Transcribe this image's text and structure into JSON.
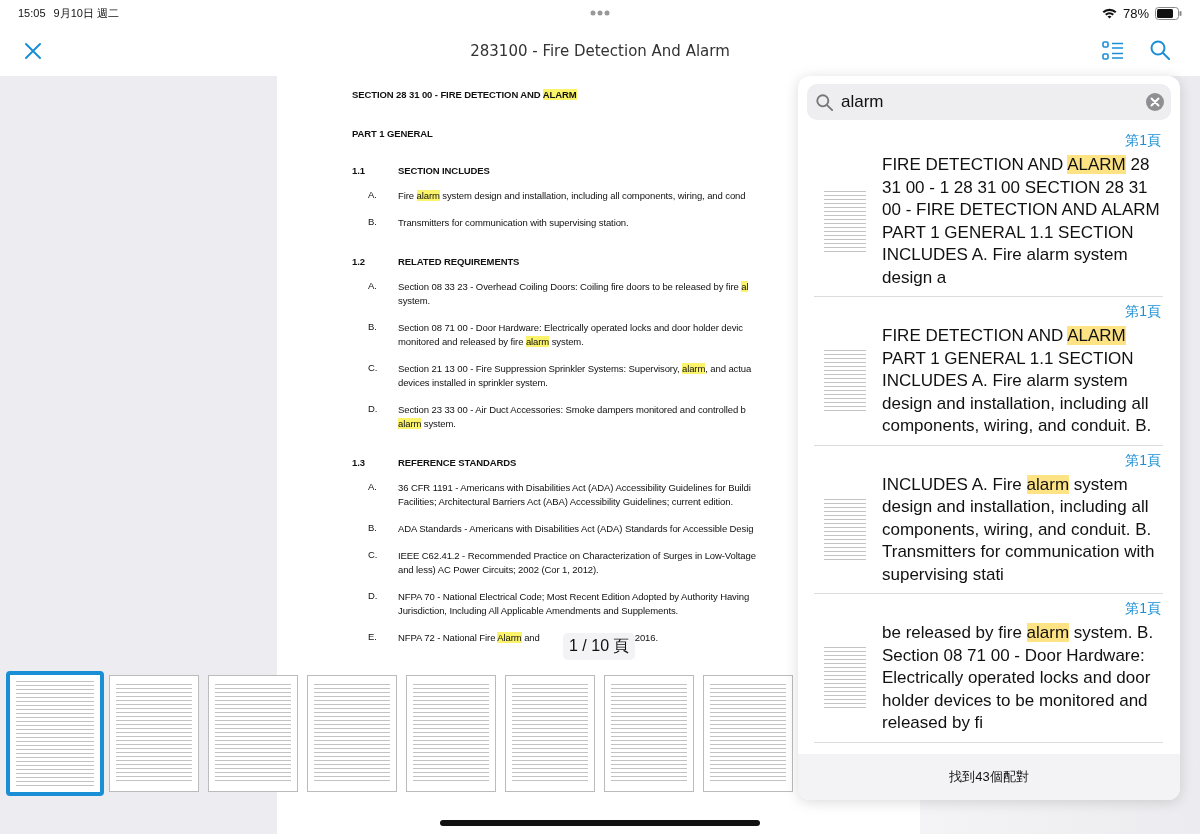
{
  "status_bar": {
    "time": "15:05",
    "date": "9月10日 週二",
    "battery": "78%"
  },
  "toolbar": {
    "title": "283100 - Fire Detection And Alarm"
  },
  "document": {
    "heading": "SECTION 28 31 00 - FIRE DETECTION AND *ALARM*",
    "part": "PART 1  GENERAL",
    "sections": [
      {
        "number": "1.1",
        "title": "SECTION INCLUDES",
        "items": [
          {
            "letter": "A.",
            "lines": [
              "Fire *alarm* system design and installation, including all components, wiring, and cond"
            ]
          },
          {
            "letter": "B.",
            "lines": [
              "Transmitters for communication with supervising station."
            ]
          }
        ]
      },
      {
        "number": "1.2",
        "title": "RELATED REQUIREMENTS",
        "items": [
          {
            "letter": "A.",
            "lines": [
              "Section 08 33 23 - Overhead Coiling Doors:  Coiling fire doors to be released by fire *al*",
              "system."
            ]
          },
          {
            "letter": "B.",
            "lines": [
              "Section 08 71 00 - Door Hardware:  Electrically operated locks and door holder devic",
              "monitored and released by fire *alarm* system."
            ]
          },
          {
            "letter": "C.",
            "lines": [
              "Section 21 13 00 - Fire Suppression Sprinkler Systems:  Supervisory, *alarm*, and actua",
              "devices installed in sprinkler system."
            ]
          },
          {
            "letter": "D.",
            "lines": [
              "Section 23 33 00 - Air Duct Accessories:  Smoke dampers monitored and controlled b",
              "*alarm* system."
            ]
          }
        ]
      },
      {
        "number": "1.3",
        "title": "REFERENCE STANDARDS",
        "items": [
          {
            "letter": "A.",
            "lines": [
              "36 CFR 1191 - Americans with Disabilities Act (ADA) Accessibility Guidelines for Buildi",
              "Facilities; Architectural Barriers Act (ABA) Accessibility Guidelines; current edition."
            ]
          },
          {
            "letter": "B.",
            "lines": [
              "ADA Standards - Americans with Disabilities Act (ADA) Standards for Accessible Desig"
            ]
          },
          {
            "letter": "C.",
            "lines": [
              "IEEE C62.41.2 - Recommended Practice on Characterization of Surges in Low-Voltage",
              "and less) AC Power Circuits; 2002 (Cor 1, 2012)."
            ]
          },
          {
            "letter": "D.",
            "lines": [
              "NFPA 70 - National Electrical Code; Most Recent Edition Adopted by Authority Having",
              "Jurisdiction, Including All Applicable Amendments and Supplements."
            ]
          },
          {
            "letter": "E.",
            "lines": [
              "NFPA 72 - National Fire *Alarm* and"
            ],
            "after": "2016."
          }
        ]
      }
    ]
  },
  "page_indicator": "1 / 10 頁",
  "thumbnails": [
    {
      "selected": true
    },
    {
      "selected": false
    },
    {
      "selected": false
    },
    {
      "selected": false
    },
    {
      "selected": false
    },
    {
      "selected": false
    },
    {
      "selected": false
    },
    {
      "selected": false
    }
  ],
  "search": {
    "value": "alarm",
    "results": [
      {
        "page": "第1頁",
        "text": "FIRE DETECTION AND **ALARM** 28 31 00 - 1 28 31 00 SECTION 28 31 00 - FIRE DETECTION AND ALARM PART 1 GENERAL 1.1 SECTION INCLUDES A. Fire alarm system design a"
      },
      {
        "page": "第1頁",
        "text": "FIRE DETECTION AND **ALARM** PART 1 GENERAL 1.1 SECTION INCLUDES A. Fire alarm system design and installation, including all components, wiring, and conduit. B."
      },
      {
        "page": "第1頁",
        "text": "INCLUDES A. Fire **alarm** system design and installation, including all components, wiring, and conduit. B. Transmitters for communication with supervising stati"
      },
      {
        "page": "第1頁",
        "text": "be released by fire **alarm** system. B. Section 08 71 00 - Door Hardware: Electrically operated locks and door holder devices to be monitored and released by fi"
      }
    ],
    "match_count": "找到43個配對"
  }
}
